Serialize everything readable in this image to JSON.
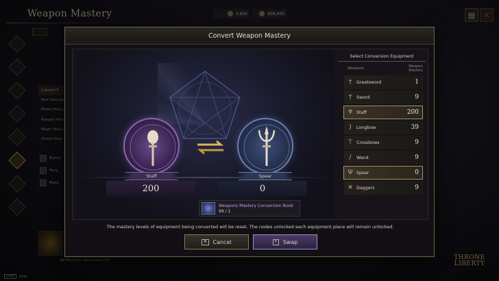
{
  "background": {
    "title": "Weapon Mastery",
    "currency_1": "3,600",
    "currency_2": "838,000",
    "list_header": "Convert F",
    "list_items": [
      "Max Damage",
      "Melee Heavy",
      "Ranged Heav",
      "Magic Heavy",
      "Amitoi Heal"
    ],
    "skill_rows": [
      "Burnin",
      "Fiery",
      "Mana"
    ],
    "footer": "All Mastery Skill Level 276",
    "chat_key": "Enter",
    "chat_label": "Chat",
    "logo_line1": "THRONE",
    "logo_line2": "LIBERTY"
  },
  "modal": {
    "title": "Convert Weapon Mastery",
    "source": {
      "name": "Staff",
      "value": "200"
    },
    "target": {
      "name": "Spear",
      "value": "0"
    },
    "panel": {
      "title": "Select Conversion Equipment",
      "col_weapons": "Weapons",
      "col_mastery": "Weapon Mastery",
      "weapons": [
        {
          "name": "Greatsword",
          "value": "1",
          "icon": "greatsword-icon",
          "selected": false
        },
        {
          "name": "Sword",
          "value": "9",
          "icon": "sword-icon",
          "selected": false
        },
        {
          "name": "Staff",
          "value": "200",
          "icon": "staff-icon",
          "selected": true
        },
        {
          "name": "Longbow",
          "value": "39",
          "icon": "longbow-icon",
          "selected": false
        },
        {
          "name": "Crossbows",
          "value": "9",
          "icon": "crossbow-icon",
          "selected": false
        },
        {
          "name": "Wand",
          "value": "9",
          "icon": "wand-icon",
          "selected": false
        },
        {
          "name": "Spear",
          "value": "0",
          "icon": "spear-icon",
          "selected": true
        },
        {
          "name": "Daggers",
          "value": "9",
          "icon": "daggers-icon",
          "selected": false
        }
      ]
    },
    "item": {
      "name": "Weapons Mastery Conversion Book",
      "count": "99 / 1"
    },
    "notice": "The mastery levels of equipment being converted will be reset. The nodes unlocked each equipment piece will remain unlocked.",
    "cancel": {
      "key": "N",
      "label": "Cancel"
    },
    "swap": {
      "key": "Y",
      "label": "Swap"
    }
  },
  "colors": {
    "accent_gold": "#a8915e",
    "purple": "#8a68b0",
    "blue": "#6b7fb0"
  }
}
